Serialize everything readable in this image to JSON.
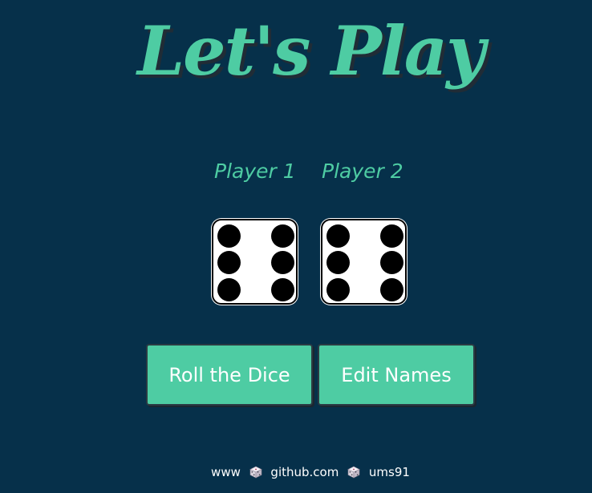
{
  "title": "Let's Play",
  "players": [
    {
      "name": "Player 1",
      "die_value": 6
    },
    {
      "name": "Player 2",
      "die_value": 6
    }
  ],
  "buttons": {
    "roll_label": "Roll the Dice",
    "edit_label": "Edit Names"
  },
  "footer": {
    "part1": "www",
    "part2": "github.com",
    "part3": "ums91",
    "separator_icon": "dice-icon"
  },
  "colors": {
    "background": "#06304a",
    "accent": "#4ecca3",
    "die_face": "#ffffff",
    "pip": "#000000"
  }
}
